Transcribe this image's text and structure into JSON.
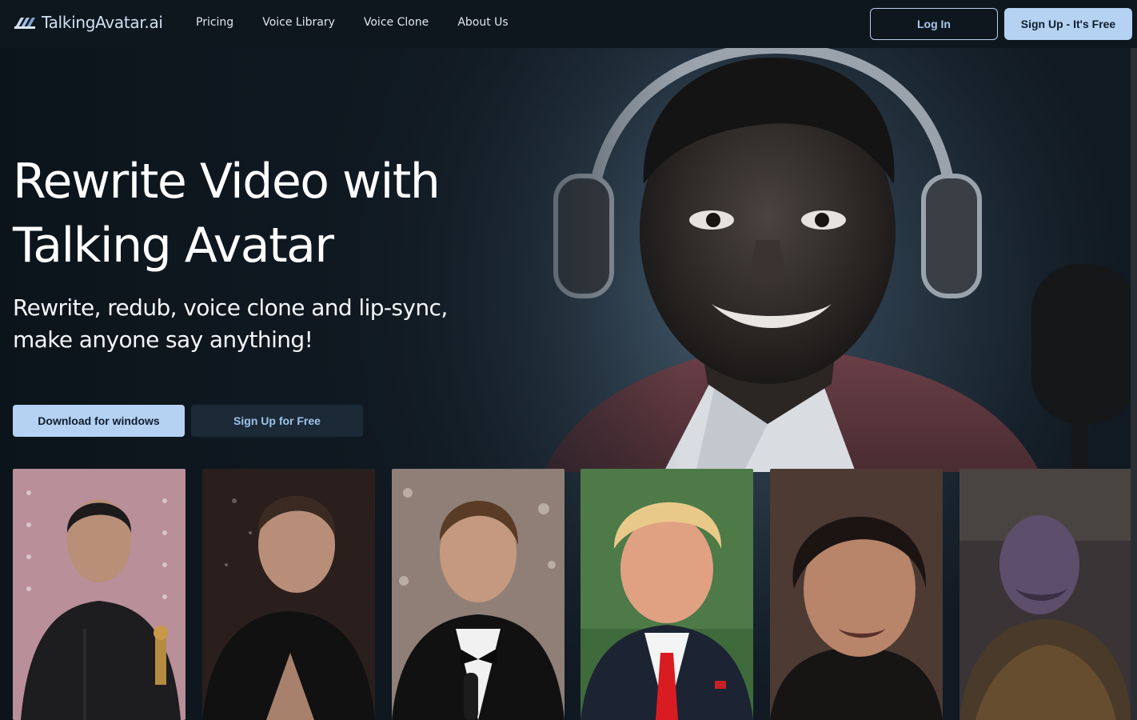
{
  "brand": {
    "name": "TalkingAvatar.ai",
    "icon": "logo-icon"
  },
  "nav": {
    "links": [
      {
        "label": "Pricing"
      },
      {
        "label": "Voice Library"
      },
      {
        "label": "Voice Clone"
      },
      {
        "label": "About Us"
      }
    ],
    "login_label": "Log In",
    "signup_label": "Sign Up - It's Free"
  },
  "hero": {
    "title_line1": "Rewrite Video with",
    "title_line2": "Talking Avatar",
    "subtitle_line1": "Rewrite, redub, voice clone and lip-sync,",
    "subtitle_line2": "make anyone say anything!",
    "download_label": "Download for windows",
    "signup_free_label": "Sign Up for Free",
    "image": "portrait-headphones-photo"
  },
  "avatar_cards": [
    {
      "image": "avatar-photo-man-with-award",
      "bg": "#b98f9a"
    },
    {
      "image": "avatar-photo-man-black-tshirt",
      "bg": "#2a1f1c"
    },
    {
      "image": "avatar-photo-man-tuxedo",
      "bg": "#8f7f77"
    },
    {
      "image": "avatar-photo-man-red-tie",
      "bg": "#4d7a47"
    },
    {
      "image": "avatar-photo-man-dark-hair",
      "bg": "#4c3a33"
    },
    {
      "image": "avatar-photo-purple-character",
      "bg": "#3a3436"
    }
  ],
  "colors": {
    "accent": "#b5d2f3",
    "accent_text": "#a9c8ee",
    "nav_bg": "#0f171e",
    "secondary_btn": "#1c2a37"
  }
}
